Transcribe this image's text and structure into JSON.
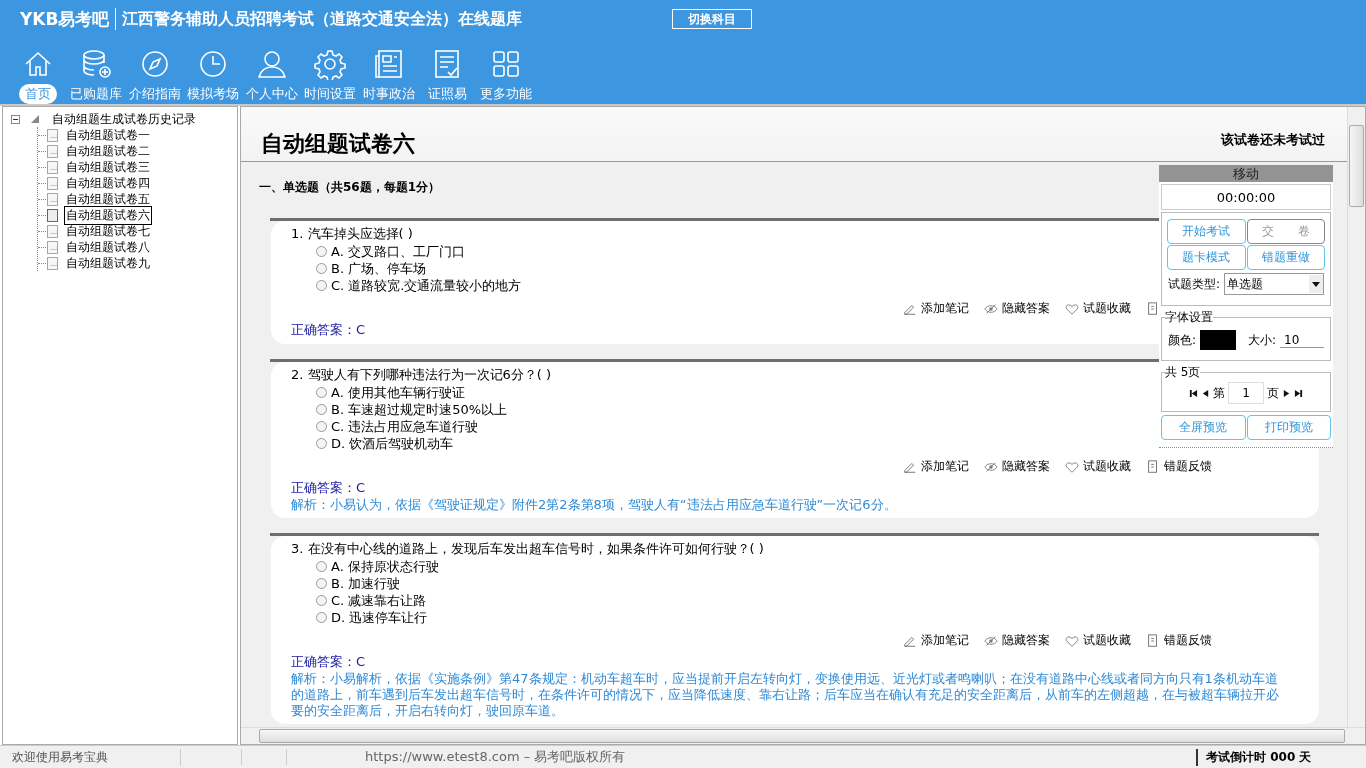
{
  "app": {
    "logo": "YKB易考吧",
    "title": "江西警务辅助人员招聘考试（道路交通安全法）在线题库",
    "switch_button": "切换科目"
  },
  "toolbar": [
    {
      "label": "首页",
      "selected": true
    },
    {
      "label": "已购题库",
      "selected": false
    },
    {
      "label": "介绍指南",
      "selected": false
    },
    {
      "label": "模拟考场",
      "selected": false
    },
    {
      "label": "个人中心",
      "selected": false
    },
    {
      "label": "时间设置",
      "selected": false
    },
    {
      "label": "时事政治",
      "selected": false
    },
    {
      "label": "证照易",
      "selected": false
    },
    {
      "label": "更多功能",
      "selected": false
    }
  ],
  "tree": {
    "label": "自动组题生成试卷历史记录",
    "expanded": true,
    "children": [
      {
        "label": "自动组题试卷一",
        "selected": false
      },
      {
        "label": "自动组题试卷二",
        "selected": false
      },
      {
        "label": "自动组题试卷三",
        "selected": false
      },
      {
        "label": "自动组题试卷四",
        "selected": false
      },
      {
        "label": "自动组题试卷五",
        "selected": false
      },
      {
        "label": "自动组题试卷六",
        "selected": true
      },
      {
        "label": "自动组题试卷七",
        "selected": false
      },
      {
        "label": "自动组题试卷八",
        "selected": false
      },
      {
        "label": "自动组题试卷九",
        "selected": false
      }
    ]
  },
  "paper": {
    "title": "自动组题试卷六",
    "status": "该试卷还未考试过",
    "section": "一、单选题（共56题，每题1分）"
  },
  "questions": [
    {
      "number": "1.",
      "text": "汽车掉头应选择( )",
      "options": [
        {
          "letter": "A.",
          "text": "交叉路口、工厂门口",
          "selected": false
        },
        {
          "letter": "B.",
          "text": "广场、停车场",
          "selected": false
        },
        {
          "letter": "C.",
          "text": "道路较宽.交通流量较小的地方",
          "selected": false
        }
      ],
      "actions": [
        "添加笔记",
        "隐藏答案",
        "试题收藏"
      ],
      "answer": "正确答案：C"
    },
    {
      "number": "2.",
      "text": "驾驶人有下列哪种违法行为一次记6分？( )",
      "options": [
        {
          "letter": "A.",
          "text": "使用其他车辆行驶证",
          "selected": false
        },
        {
          "letter": "B.",
          "text": "车速超过规定时速50%以上",
          "selected": false
        },
        {
          "letter": "C.",
          "text": "违法占用应急车道行驶",
          "selected": false
        },
        {
          "letter": "D.",
          "text": "饮酒后驾驶机动车",
          "selected": false
        }
      ],
      "actions": [
        "添加笔记",
        "隐藏答案",
        "试题收藏",
        "错题反馈"
      ],
      "answer": "正确答案：C",
      "explanation": "解析：小易认为，依据《驾驶证规定》附件2第2条第8项，驾驶人有“违法占用应急车道行驶”一次记6分。"
    },
    {
      "number": "3.",
      "text": "在没有中心线的道路上，发现后车发出超车信号时，如果条件许可如何行驶？( )",
      "options": [
        {
          "letter": "A.",
          "text": "保持原状态行驶",
          "selected": false
        },
        {
          "letter": "B.",
          "text": "加速行驶",
          "selected": false
        },
        {
          "letter": "C.",
          "text": "减速靠右让路",
          "selected": false
        },
        {
          "letter": "D.",
          "text": "迅速停车让行",
          "selected": false
        }
      ],
      "actions": [
        "添加笔记",
        "隐藏答案",
        "试题收藏",
        "错题反馈"
      ],
      "answer": "正确答案：C",
      "explanation": "解析：小易解析，依据《实施条例》第47条规定：机动车超车时，应当提前开启左转向灯，变换使用远、近光灯或者鸣喇叭；在没有道路中心线或者同方向只有1条机动车道的道路上，前车遇到后车发出超车信号时，在条件许可的情况下，应当降低速度、靠右让路；后车应当在确认有充足的安全距离后，从前车的左侧超越，在与被超车辆拉开必要的安全距离后，开启右转向灯，驶回原车道。"
    }
  ],
  "exam_panel": {
    "header": "移动",
    "timer": "00:00:00",
    "buttons": [
      {
        "label": "开始考试",
        "disabled": false
      },
      {
        "label": "交　　卷",
        "disabled": true
      },
      {
        "label": "题卡模式",
        "disabled": false
      },
      {
        "label": "错题重做",
        "disabled": false
      }
    ],
    "type_label": "试题类型:",
    "type_value": "单选题",
    "font_group": "字体设置",
    "color_label": "颜色:",
    "size_label": "大小:",
    "size_value": "10",
    "pages_group": "共 5页",
    "page_prefix": "第",
    "page_value": "1",
    "page_suffix": "页",
    "bottom_buttons": [
      "全屏预览",
      "打印预览"
    ]
  },
  "status_bar": {
    "welcome": "欢迎使用易考宝典",
    "copyright": "https://www.etest8.com – 易考吧版权所有",
    "countdown": "考试倒计时 000 天"
  }
}
